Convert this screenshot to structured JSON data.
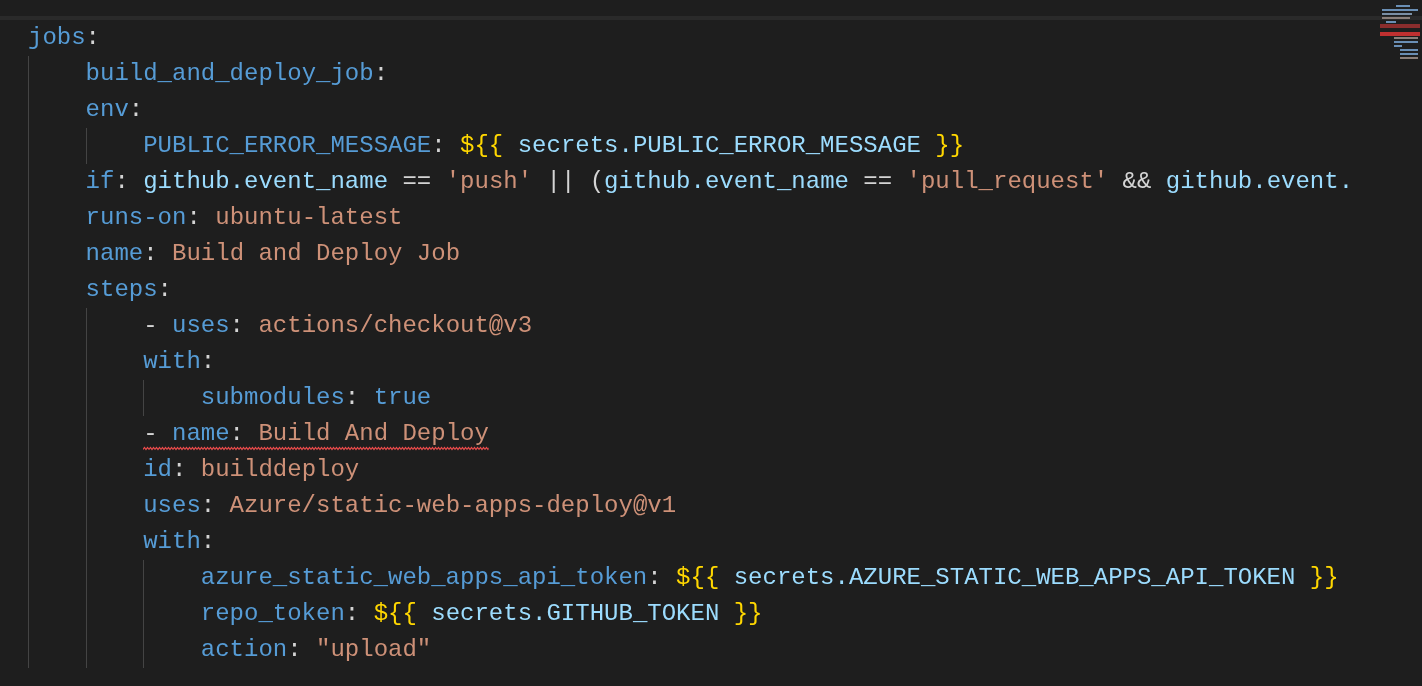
{
  "editor": {
    "lines": [
      {
        "error": false,
        "tokens": [
          {
            "kind": "key",
            "text": "jobs"
          },
          {
            "kind": "punct",
            "text": ":"
          }
        ]
      },
      {
        "error": false,
        "tokens": [
          {
            "kind": "key",
            "text": "    build_and_deploy_job"
          },
          {
            "kind": "punct",
            "text": ":"
          }
        ]
      },
      {
        "error": false,
        "tokens": [
          {
            "kind": "key",
            "text": "    env"
          },
          {
            "kind": "punct",
            "text": ":"
          }
        ]
      },
      {
        "error": false,
        "tokens": [
          {
            "kind": "key",
            "text": "        PUBLIC_ERROR_MESSAGE"
          },
          {
            "kind": "punct",
            "text": ": "
          },
          {
            "kind": "brace",
            "text": "${{"
          },
          {
            "kind": "var",
            "text": " secrets.PUBLIC_ERROR_MESSAGE "
          },
          {
            "kind": "brace",
            "text": "}}"
          }
        ]
      },
      {
        "error": false,
        "tokens": [
          {
            "kind": "key",
            "text": "    if"
          },
          {
            "kind": "punct",
            "text": ": "
          },
          {
            "kind": "var",
            "text": "github.event_name"
          },
          {
            "kind": "punct",
            "text": " == "
          },
          {
            "kind": "string",
            "text": "'push'"
          },
          {
            "kind": "punct",
            "text": " || ("
          },
          {
            "kind": "var",
            "text": "github.event_name"
          },
          {
            "kind": "punct",
            "text": " == "
          },
          {
            "kind": "string",
            "text": "'pull_request'"
          },
          {
            "kind": "punct",
            "text": " && "
          },
          {
            "kind": "var",
            "text": "github.event."
          }
        ]
      },
      {
        "error": false,
        "tokens": [
          {
            "kind": "key",
            "text": "    runs-on"
          },
          {
            "kind": "punct",
            "text": ": "
          },
          {
            "kind": "string",
            "text": "ubuntu-latest"
          }
        ]
      },
      {
        "error": false,
        "tokens": [
          {
            "kind": "key",
            "text": "    name"
          },
          {
            "kind": "punct",
            "text": ": "
          },
          {
            "kind": "string",
            "text": "Build and Deploy Job"
          }
        ]
      },
      {
        "error": false,
        "tokens": [
          {
            "kind": "key",
            "text": "    steps"
          },
          {
            "kind": "punct",
            "text": ":"
          }
        ]
      },
      {
        "error": false,
        "tokens": [
          {
            "kind": "punct",
            "text": "        - "
          },
          {
            "kind": "key",
            "text": "uses"
          },
          {
            "kind": "punct",
            "text": ": "
          },
          {
            "kind": "string",
            "text": "actions/checkout@v3"
          }
        ]
      },
      {
        "error": false,
        "tokens": [
          {
            "kind": "key",
            "text": "        with"
          },
          {
            "kind": "punct",
            "text": ":"
          }
        ]
      },
      {
        "error": false,
        "tokens": [
          {
            "kind": "key",
            "text": "            submodules"
          },
          {
            "kind": "punct",
            "text": ": "
          },
          {
            "kind": "bool",
            "text": "true"
          }
        ]
      },
      {
        "error": true,
        "tokens": [
          {
            "kind": "punct",
            "text": "        - "
          },
          {
            "kind": "key",
            "text": "name"
          },
          {
            "kind": "punct",
            "text": ": "
          },
          {
            "kind": "string",
            "text": "Build And Deploy"
          }
        ]
      },
      {
        "error": false,
        "tokens": [
          {
            "kind": "key",
            "text": "        id"
          },
          {
            "kind": "punct",
            "text": ": "
          },
          {
            "kind": "string",
            "text": "builddeploy"
          }
        ]
      },
      {
        "error": false,
        "tokens": [
          {
            "kind": "key",
            "text": "        uses"
          },
          {
            "kind": "punct",
            "text": ": "
          },
          {
            "kind": "string",
            "text": "Azure/static-web-apps-deploy@v1"
          }
        ]
      },
      {
        "error": false,
        "tokens": [
          {
            "kind": "key",
            "text": "        with"
          },
          {
            "kind": "punct",
            "text": ":"
          }
        ]
      },
      {
        "error": false,
        "tokens": [
          {
            "kind": "key",
            "text": "            azure_static_web_apps_api_token"
          },
          {
            "kind": "punct",
            "text": ": "
          },
          {
            "kind": "brace",
            "text": "${{"
          },
          {
            "kind": "var",
            "text": " secrets.AZURE_STATIC_WEB_APPS_API_TOKEN "
          },
          {
            "kind": "brace",
            "text": "}}"
          }
        ]
      },
      {
        "error": false,
        "tokens": [
          {
            "kind": "key",
            "text": "            repo_token"
          },
          {
            "kind": "punct",
            "text": ": "
          },
          {
            "kind": "brace",
            "text": "${{"
          },
          {
            "kind": "var",
            "text": " secrets.GITHUB_TOKEN "
          },
          {
            "kind": "brace",
            "text": "}}"
          }
        ]
      },
      {
        "error": false,
        "tokens": [
          {
            "kind": "key",
            "text": "            action"
          },
          {
            "kind": "punct",
            "text": ": "
          },
          {
            "kind": "string",
            "text": "\"upload\""
          }
        ]
      }
    ]
  }
}
